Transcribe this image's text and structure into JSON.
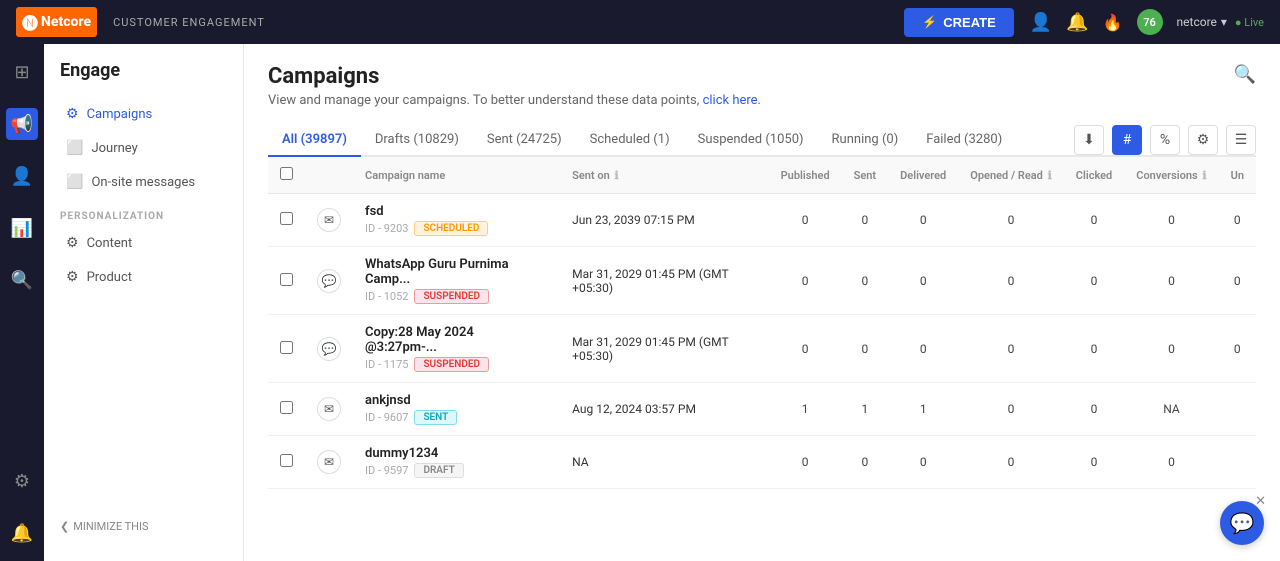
{
  "app": {
    "logo_text": "Netcore",
    "logo_n": "N",
    "section_label": "CUSTOMER ENGAGEMENT",
    "create_label": "CREATE",
    "user_name": "netcore",
    "status": "Live",
    "notification_count": "76"
  },
  "sidebar": {
    "title": "Engage",
    "items": [
      {
        "id": "campaigns",
        "label": "Campaigns",
        "icon": "📢",
        "active": true
      },
      {
        "id": "journey",
        "label": "Journey",
        "icon": "🗺"
      },
      {
        "id": "on-site",
        "label": "On-site messages",
        "icon": "💬"
      }
    ],
    "personalization_label": "PERSONALIZATION",
    "personalization_items": [
      {
        "id": "content",
        "label": "Content",
        "icon": "📄"
      },
      {
        "id": "product",
        "label": "Product",
        "icon": "📦"
      }
    ],
    "minimize_label": "MINIMIZE THIS"
  },
  "page": {
    "title": "Campaigns",
    "subtitle": "View and manage your campaigns. To better understand these data points,",
    "subtitle_link": "click here.",
    "search_tooltip": "Search"
  },
  "tabs": [
    {
      "id": "all",
      "label": "All (39897)",
      "active": true
    },
    {
      "id": "drafts",
      "label": "Drafts (10829)"
    },
    {
      "id": "sent",
      "label": "Sent (24725)"
    },
    {
      "id": "scheduled",
      "label": "Scheduled (1)"
    },
    {
      "id": "suspended",
      "label": "Suspended (1050)"
    },
    {
      "id": "running",
      "label": "Running (0)"
    },
    {
      "id": "failed",
      "label": "Failed (3280)"
    }
  ],
  "toolbar": {
    "download_icon": "⬇",
    "hash_icon": "#",
    "percent_icon": "%",
    "settings_icon": "⚙",
    "filter_icon": "☰"
  },
  "table": {
    "columns": [
      {
        "id": "checkbox",
        "label": ""
      },
      {
        "id": "channel",
        "label": ""
      },
      {
        "id": "name",
        "label": "Campaign name"
      },
      {
        "id": "sent_on",
        "label": "Sent on",
        "info": true
      },
      {
        "id": "published",
        "label": "Published"
      },
      {
        "id": "sent",
        "label": "Sent"
      },
      {
        "id": "delivered",
        "label": "Delivered"
      },
      {
        "id": "opened",
        "label": "Opened / Read",
        "info": true
      },
      {
        "id": "clicked",
        "label": "Clicked"
      },
      {
        "id": "conversions",
        "label": "Conversions",
        "info": true
      },
      {
        "id": "un",
        "label": "Un"
      }
    ],
    "rows": [
      {
        "id": "9203",
        "channel": "email",
        "name": "fsd",
        "badge": "SCHEDULED",
        "badge_type": "scheduled",
        "sent_on": "Jun 23, 2039 07:15 PM",
        "published": "0",
        "sent": "0",
        "delivered": "0",
        "opened": "0",
        "clicked": "0",
        "conversions": "0",
        "un": "0"
      },
      {
        "id": "1052",
        "channel": "whatsapp",
        "name": "WhatsApp Guru Purnima Camp...",
        "badge": "SUSPENDED",
        "badge_type": "suspended",
        "sent_on": "Mar 31, 2029 01:45 PM (GMT +05:30)",
        "published": "0",
        "sent": "0",
        "delivered": "0",
        "opened": "0",
        "clicked": "0",
        "conversions": "0",
        "un": "0"
      },
      {
        "id": "1175",
        "channel": "whatsapp",
        "name": "Copy:28 May 2024 @3:27pm-...",
        "badge": "SUSPENDED",
        "badge_type": "suspended",
        "sent_on": "Mar 31, 2029 01:45 PM (GMT +05:30)",
        "published": "0",
        "sent": "0",
        "delivered": "0",
        "opened": "0",
        "clicked": "0",
        "conversions": "0",
        "un": "0"
      },
      {
        "id": "9607",
        "channel": "email",
        "name": "ankjnsd",
        "badge": "SENT",
        "badge_type": "sent",
        "sent_on": "Aug 12, 2024 03:57 PM",
        "published": "1",
        "sent": "1",
        "delivered": "1",
        "opened": "0",
        "clicked": "0",
        "conversions": "NA",
        "un": ""
      },
      {
        "id": "9597",
        "channel": "email",
        "name": "dummy1234",
        "badge": "DRAFT",
        "badge_type": "draft",
        "sent_on": "NA",
        "published": "0",
        "sent": "0",
        "delivered": "0",
        "opened": "0",
        "clicked": "0",
        "conversions": "0",
        "un": ""
      }
    ]
  }
}
